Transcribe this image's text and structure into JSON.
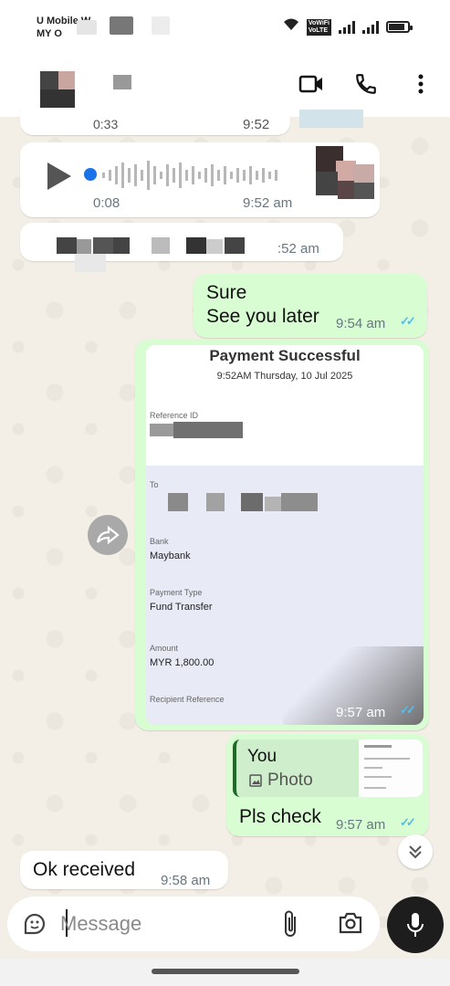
{
  "status_bar": {
    "carrier_line1": "U Mobile W",
    "carrier_line2": "MY O",
    "wifi_badge_top": "VoWiFi",
    "wifi_badge_bottom": "VoLTE"
  },
  "header": {
    "video_call_icon": "video-camera-icon",
    "voice_call_icon": "phone-icon",
    "menu_icon": "more-vertical-icon"
  },
  "messages": {
    "partial_top": {
      "left_text": "0:33",
      "time": "9:52"
    },
    "voice_note": {
      "duration": "0:08",
      "time": "9:52 am"
    },
    "redacted_msg": {
      "time": ":52 am"
    },
    "sure": {
      "line1": "Sure",
      "line2": "See you later",
      "time": "9:54 am",
      "status": "read"
    },
    "receipt": {
      "title": "Payment Successful",
      "datetime": "9:52AM Thursday, 10 Jul 2025",
      "reference_label": "Reference ID",
      "to_label": "To",
      "bank_label": "Bank",
      "bank_value": "Maybank",
      "payment_type_label": "Payment Type",
      "payment_type_value": "Fund Transfer",
      "amount_label": "Amount",
      "amount_value": "MYR 1,800.00",
      "recipient_ref_label": "Recipient Reference",
      "time": "9:57 am",
      "status": "read"
    },
    "reply": {
      "quoted_author": "You",
      "quoted_type": "Photo",
      "text": "Pls check",
      "time": "9:57 am",
      "status": "read"
    },
    "incoming_ok": {
      "text": "Ok received",
      "time": "9:58 am"
    }
  },
  "composer": {
    "placeholder": "Message",
    "emoji_icon": "sticker-icon",
    "attach_icon": "paperclip-icon",
    "camera_icon": "camera-icon",
    "mic_icon": "mic-icon"
  },
  "colors": {
    "outgoing_bubble": "#d9fdd3",
    "incoming_bubble": "#ffffff",
    "read_ticks": "#53bdeb",
    "voice_dot": "#1a73e8"
  }
}
